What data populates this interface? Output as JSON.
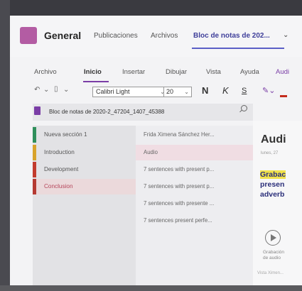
{
  "header": {
    "channel": "General",
    "tabs": [
      "Publicaciones",
      "Archivos",
      "Bloc de notas de 202..."
    ]
  },
  "ribbon": {
    "tabs": [
      "Archivo",
      "Inicio",
      "Insertar",
      "Dibujar",
      "Vista",
      "Ayuda",
      "Audi"
    ],
    "font": "Calibri Light",
    "size": "20",
    "bold": "N",
    "italic": "K",
    "underline": "S"
  },
  "notebook": {
    "name": "Bloc de notas de 2020-2_47204_1407_45388"
  },
  "sections": [
    "Nueva sección 1",
    "Introduction",
    "Development",
    "Conclusion"
  ],
  "section_colors": [
    "#2f8f5b",
    "#d8a32b",
    "#c23b2d",
    "#b53a32"
  ],
  "pages": [
    "Frida Ximena Sánchez Her...",
    "Audio",
    "7 sentences with present p...",
    "7 sentences with present p...",
    "7 sentences with presente ...",
    "7 sentences present perfe..."
  ],
  "content": {
    "title": "Audi",
    "date": "lunes, 27",
    "lines": [
      "Grabac",
      "presen",
      "adverb"
    ],
    "recording": [
      "Grabación",
      "de audio"
    ],
    "view": "Vista Ximen..."
  }
}
